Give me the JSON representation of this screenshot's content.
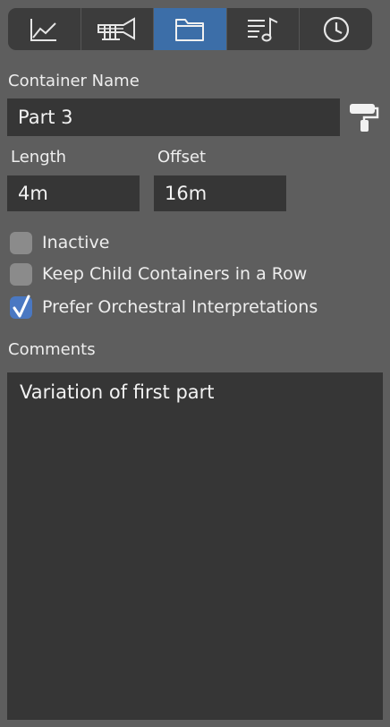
{
  "toolbar": {
    "tabs": [
      {
        "icon": "chart-line-icon",
        "active": false
      },
      {
        "icon": "trumpet-icon",
        "active": false
      },
      {
        "icon": "folder-icon",
        "active": true
      },
      {
        "icon": "music-list-icon",
        "active": false
      },
      {
        "icon": "clock-icon",
        "active": false
      }
    ],
    "active_color": "#3c6ea8"
  },
  "container": {
    "name_label": "Container Name",
    "name_value": "Part 3",
    "length_label": "Length",
    "length_value": "4m",
    "offset_label": "Offset",
    "offset_value": "16m"
  },
  "options": {
    "inactive_label": "Inactive",
    "inactive_checked": false,
    "keep_row_label": "Keep Child Containers in a Row",
    "keep_row_checked": false,
    "orchestral_label": "Prefer Orchestral Interpretations",
    "orchestral_checked": true
  },
  "comments": {
    "label": "Comments",
    "value": "Variation of first part"
  }
}
